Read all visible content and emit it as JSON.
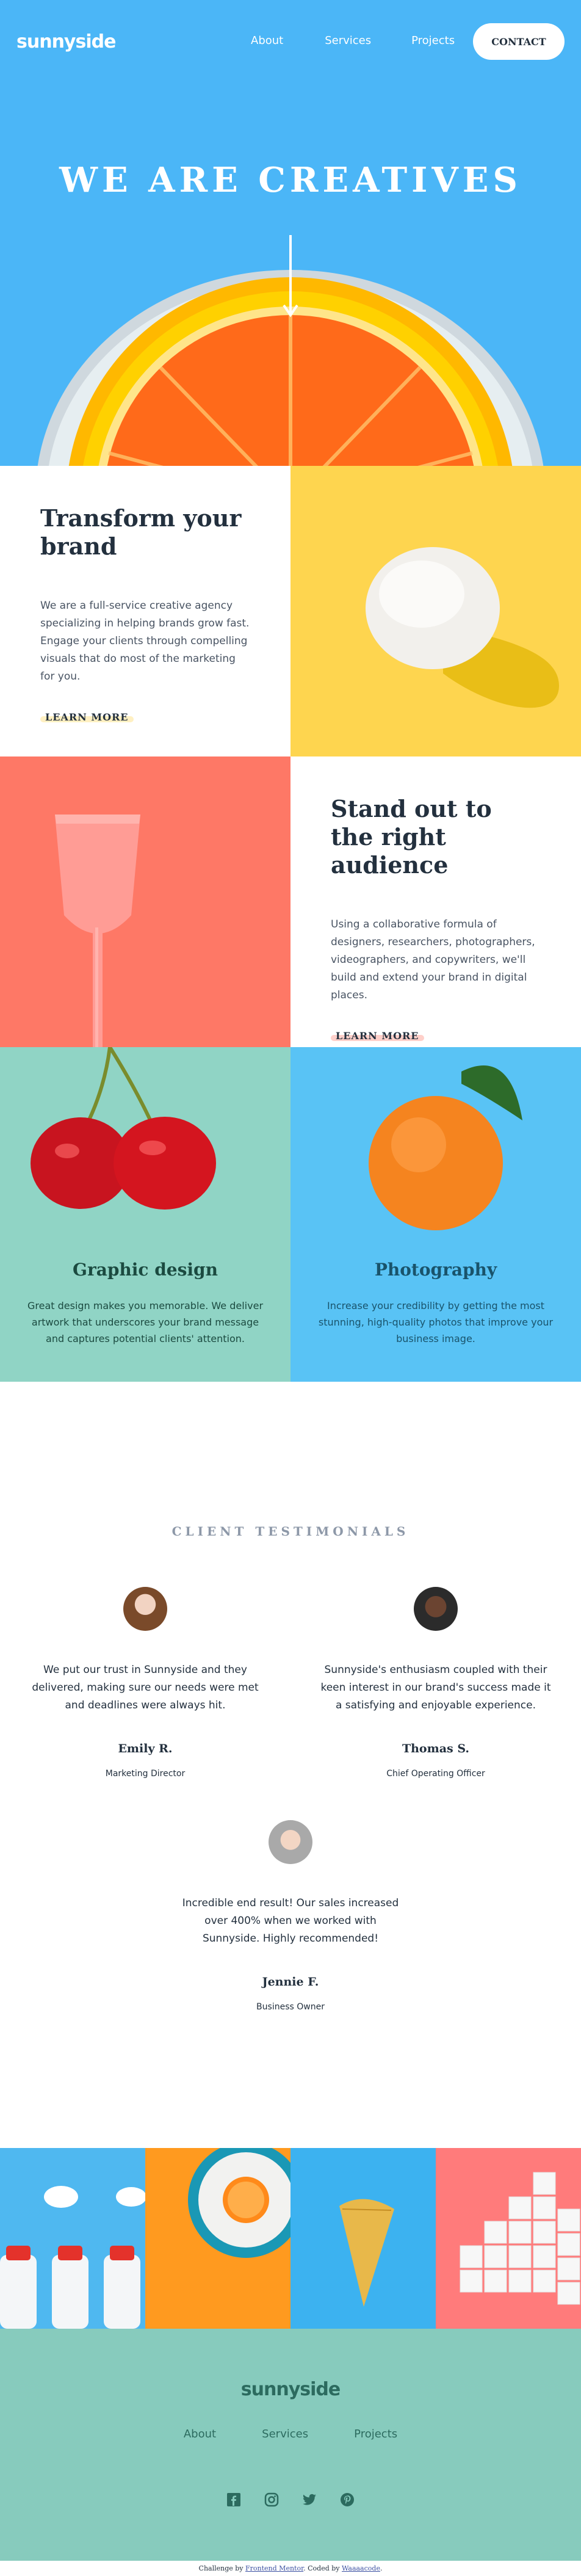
{
  "header": {
    "logo": "sunnyside",
    "nav": [
      "About",
      "Services",
      "Projects"
    ],
    "contact_label": "CONTACT"
  },
  "hero": {
    "title": "WE ARE CREATIVES"
  },
  "features": {
    "transform": {
      "title": "Transform your brand",
      "body": "We are a full-service creative agency specializing in helping brands grow fast. Engage your clients through compelling visuals that do most of the marketing for you.",
      "link": "LEARN MORE"
    },
    "standout": {
      "title": "Stand out to the right audience",
      "body": "Using a collaborative formula of designers, researchers, photographers, videographers, and copywriters, we'll build and extend your brand in digital places.",
      "link": "LEARN MORE"
    }
  },
  "services": {
    "graphic": {
      "title": "Graphic design",
      "body": "Great design makes you memorable. We deliver artwork that underscores your brand message and captures potential clients' attention."
    },
    "photo": {
      "title": "Photography",
      "body": "Increase your credibility by getting the most stunning, high-quality photos that improve your business image."
    }
  },
  "testimonials": {
    "heading": "CLIENT TESTIMONIALS",
    "items": [
      {
        "quote": "We put our trust in Sunnyside and they delivered, making sure our needs were met and deadlines were always hit.",
        "name": "Emily R.",
        "role": "Marketing Director"
      },
      {
        "quote": "Sunnyside's enthusiasm coupled with their keen interest in our brand's success made it a satisfying and enjoyable experience.",
        "name": "Thomas S.",
        "role": "Chief Operating Officer"
      },
      {
        "quote": "Incredible end result! Our sales increased over 400% when we worked with Sunnyside. Highly recommended!",
        "name": "Jennie F.",
        "role": "Business Owner"
      }
    ]
  },
  "footer": {
    "logo": "sunnyside",
    "nav": [
      "About",
      "Services",
      "Projects"
    ],
    "social": [
      "facebook-icon",
      "instagram-icon",
      "twitter-icon",
      "pinterest-icon"
    ]
  },
  "attribution": {
    "prefix": "Challenge by",
    "fm": "Frontend Mentor",
    "middle": ". Coded by",
    "author": "Waaaacode",
    "suffix": "."
  },
  "colors": {
    "hero_bg": "#4bb6f7",
    "yellow": "#fed54f",
    "salmon": "#fe7866",
    "mint": "#90d4c5",
    "footer": "#87cbbd",
    "dark": "#23303e"
  }
}
